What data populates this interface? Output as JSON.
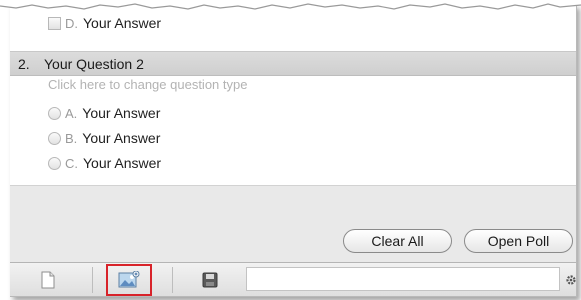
{
  "question_1": {
    "answers": [
      {
        "letter": "D.",
        "text": "Your Answer"
      }
    ]
  },
  "question_2": {
    "number": "2.",
    "title": "Your Question 2",
    "type_hint": "Click here to change question type",
    "answers": [
      {
        "letter": "A.",
        "text": "Your Answer"
      },
      {
        "letter": "B.",
        "text": "Your Answer"
      },
      {
        "letter": "C.",
        "text": "Your Answer"
      }
    ]
  },
  "buttons": {
    "clear_all": "Clear All",
    "open_poll": "Open Poll"
  },
  "toolbar": {
    "icons": [
      "new-document-icon",
      "image-icon",
      "save-icon",
      "gear-icon"
    ],
    "selected_icon": "image-icon",
    "highlight_color": "#d8232a"
  }
}
